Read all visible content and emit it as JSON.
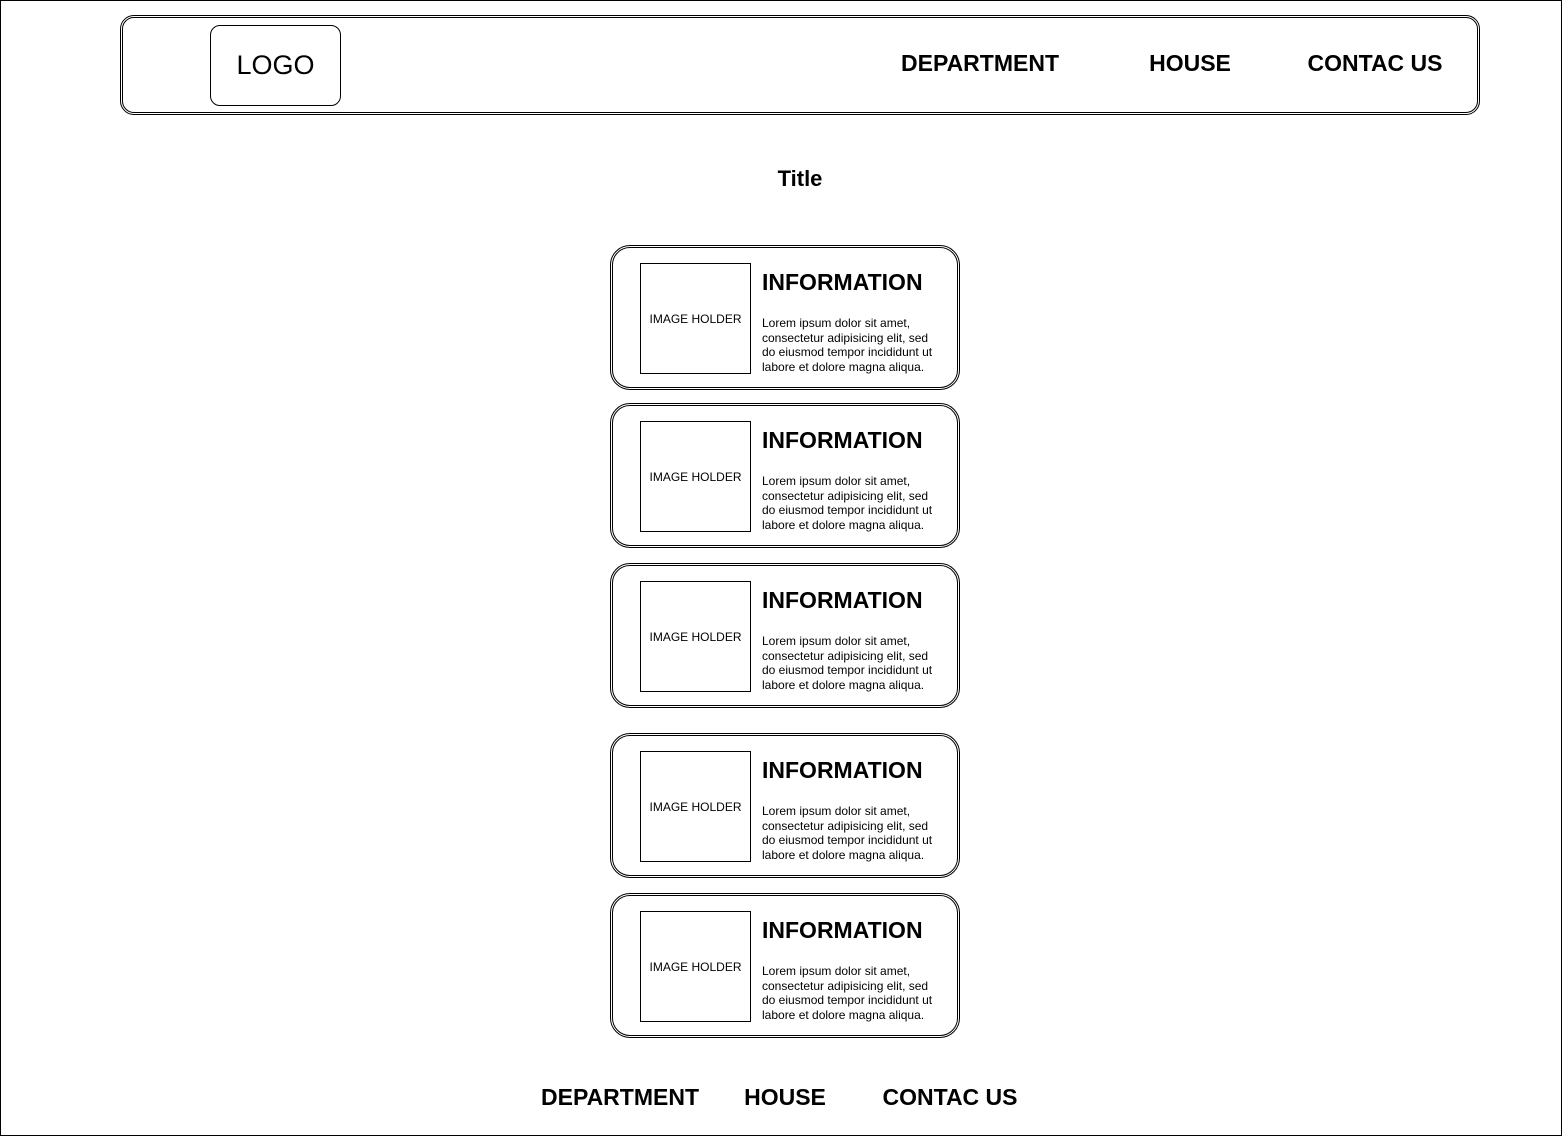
{
  "header": {
    "logo": "LOGO",
    "nav": [
      "DEPARTMENT",
      "HOUSE",
      "CONTAC US"
    ]
  },
  "page_title": "Title",
  "cards": [
    {
      "image": "IMAGE HOLDER",
      "heading": "INFORMATION",
      "text": "Lorem ipsum dolor sit amet, consectetur adipisicing elit, sed do eiusmod tempor incididunt ut labore et dolore magna aliqua."
    },
    {
      "image": "IMAGE HOLDER",
      "heading": "INFORMATION",
      "text": "Lorem ipsum dolor sit amet, consectetur adipisicing elit, sed do eiusmod tempor incididunt ut labore et dolore magna aliqua."
    },
    {
      "image": "IMAGE HOLDER",
      "heading": "INFORMATION",
      "text": "Lorem ipsum dolor sit amet, consectetur adipisicing elit, sed do eiusmod tempor incididunt ut labore et dolore magna aliqua."
    },
    {
      "image": "IMAGE HOLDER",
      "heading": "INFORMATION",
      "text": "Lorem ipsum dolor sit amet, consectetur adipisicing elit, sed do eiusmod tempor incididunt ut labore et dolore magna aliqua."
    },
    {
      "image": "IMAGE HOLDER",
      "heading": "INFORMATION",
      "text": "Lorem ipsum dolor sit amet, consectetur adipisicing elit, sed do eiusmod tempor incididunt ut labore et dolore magna aliqua."
    }
  ],
  "footer": {
    "nav": [
      "DEPARTMENT",
      "HOUSE",
      "CONTAC US"
    ]
  }
}
